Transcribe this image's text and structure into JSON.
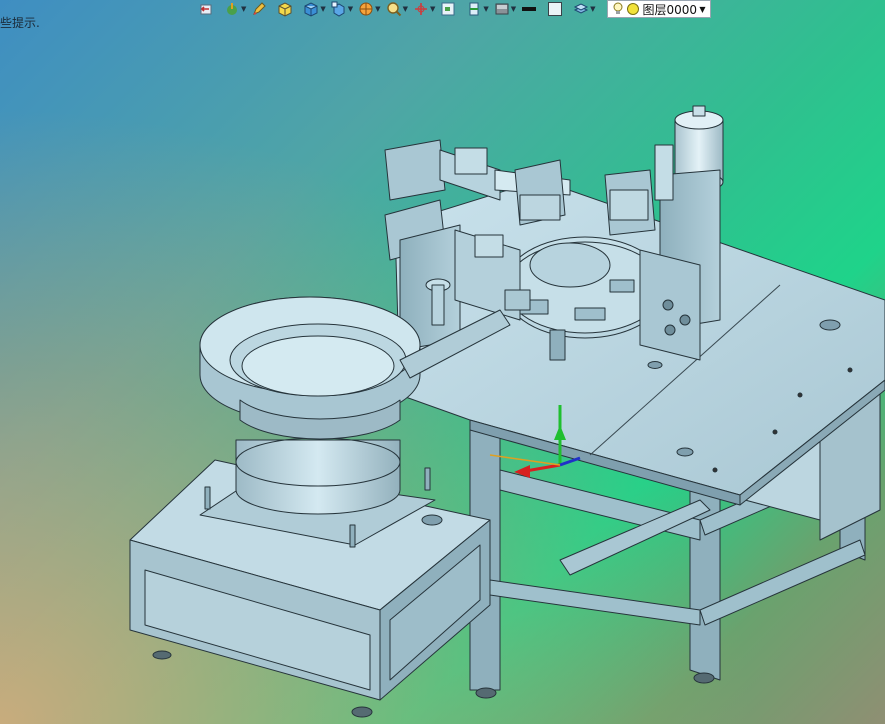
{
  "status": {
    "hint_text": "些提示."
  },
  "toolbar": {
    "buttons": [
      {
        "id": "undo",
        "icon": "history-icon",
        "dropdown": false
      },
      {
        "id": "snap",
        "icon": "magnet-pick-icon",
        "dropdown": true
      },
      {
        "id": "pen",
        "icon": "pencil-icon",
        "dropdown": false
      },
      {
        "id": "shade",
        "icon": "shaded-cube-icon",
        "dropdown": false
      },
      {
        "id": "view",
        "icon": "blue-cube-icon",
        "dropdown": true
      },
      {
        "id": "std-views",
        "icon": "view-cube-icon",
        "dropdown": true
      },
      {
        "id": "render",
        "icon": "render-sphere-icon",
        "dropdown": true
      },
      {
        "id": "zoom",
        "icon": "zoom-fit-icon",
        "dropdown": true
      },
      {
        "id": "csys",
        "icon": "coordinate-axes-icon",
        "dropdown": true
      },
      {
        "id": "frame",
        "icon": "frame-view-icon",
        "dropdown": false
      },
      {
        "id": "section",
        "icon": "section-plane-icon",
        "dropdown": true
      },
      {
        "id": "display",
        "icon": "display-mode-icon",
        "dropdown": true
      },
      {
        "id": "line",
        "icon": "line-style-icon",
        "dropdown": false
      },
      {
        "id": "fill",
        "icon": "fill-color-icon",
        "dropdown": false
      },
      {
        "id": "layer-mgr",
        "icon": "layers-icon",
        "dropdown": true
      }
    ],
    "layer": {
      "label": "图层0000",
      "bulb_icon": "lightbulb-icon",
      "color_icon": "layer-color-icon"
    }
  },
  "scene": {
    "colors": {
      "metal": "#b7d3de",
      "metal_dark": "#7f9fae",
      "edge": "#26343b"
    }
  }
}
